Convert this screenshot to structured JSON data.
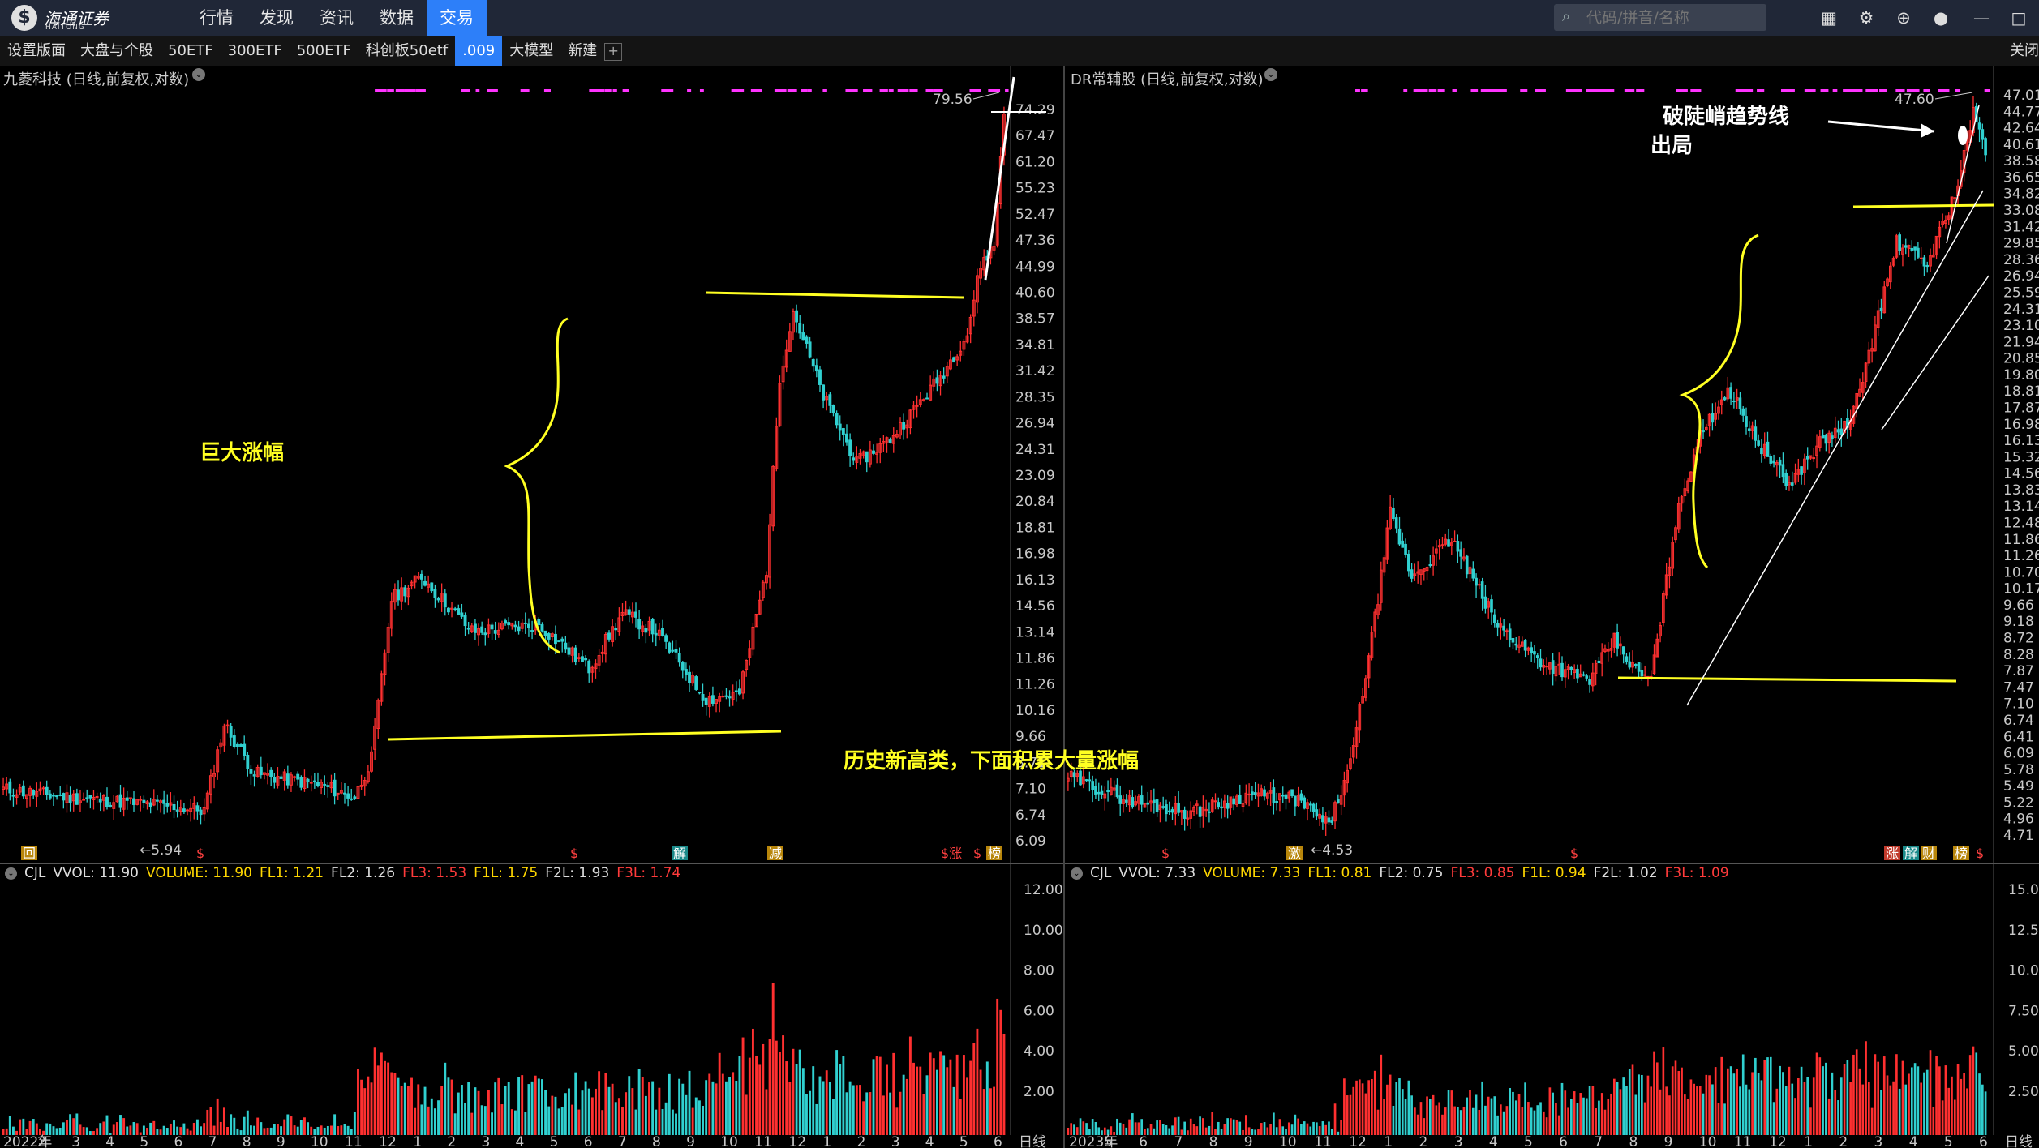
{
  "app": {
    "logo_glyph": "$",
    "logo_name": "海通证券",
    "logo_sub": "HAITONG"
  },
  "nav": [
    {
      "label": "行情",
      "active": false
    },
    {
      "label": "发现",
      "active": false
    },
    {
      "label": "资讯",
      "active": false
    },
    {
      "label": "数据",
      "active": false
    },
    {
      "label": "交易",
      "active": true
    }
  ],
  "search": {
    "placeholder": "代码/拼音/名称",
    "icon": "search-icon"
  },
  "top_icons": [
    "grid-icon",
    "gear-icon",
    "globe-icon",
    "chat-icon"
  ],
  "window_controls": {
    "minimize": "—",
    "maximize": "□"
  },
  "toolbar": {
    "items": [
      {
        "label": "设置版面",
        "active": false
      },
      {
        "label": "大盘与个股",
        "active": false
      },
      {
        "label": "50ETF",
        "active": false
      },
      {
        "label": "300ETF",
        "active": false
      },
      {
        "label": "500ETF",
        "active": false
      },
      {
        "label": "科创板50etf",
        "active": false
      },
      {
        "label": ".009",
        "active": true
      },
      {
        "label": "大模型",
        "active": false
      },
      {
        "label": "新建",
        "active": false
      }
    ],
    "plus": "+",
    "right_label": "关闭"
  },
  "left_panel": {
    "title": "九菱科技 (日线,前复权,对数)",
    "y_labels": [
      "74.29",
      "67.47",
      "61.20",
      "55.23",
      "52.47",
      "47.36",
      "44.99",
      "40.60",
      "38.57",
      "34.81",
      "31.42",
      "28.35",
      "26.94",
      "24.31",
      "23.09",
      "20.84",
      "18.81",
      "16.98",
      "16.13",
      "14.56",
      "13.14",
      "11.86",
      "11.26",
      "10.16",
      "9.66",
      "8.71",
      "7.10",
      "6.74",
      "6.09"
    ],
    "high_label": "79.56",
    "low_label": "←5.94",
    "annotation_big": "巨大涨幅",
    "annotation_history": "历史新高类，下面积累大量涨幅",
    "markers": [
      "回",
      "$",
      "$",
      "解",
      "减",
      "$涨",
      "$",
      "榜"
    ],
    "indicator": {
      "name": "CJL",
      "items": [
        {
          "text": "VVOL: 11.90",
          "color": "#dddddd"
        },
        {
          "text": "VOLUME: 11.90",
          "color": "#ffd700"
        },
        {
          "text": "FL1: 1.21",
          "color": "#ffd700"
        },
        {
          "text": "FL2: 1.26",
          "color": "#dddddd"
        },
        {
          "text": "FL3: 1.53",
          "color": "#ff3b3b"
        },
        {
          "text": "F1L: 1.75",
          "color": "#ffd700"
        },
        {
          "text": "F2L: 1.93",
          "color": "#dddddd"
        },
        {
          "text": "F3L: 1.74",
          "color": "#ff3b3b"
        }
      ]
    },
    "vol_labels": [
      "12.00",
      "10.00",
      "8.00",
      "6.00",
      "4.00",
      "2.00"
    ],
    "x_labels": [
      "2022年",
      "2",
      "3",
      "4",
      "5",
      "6",
      "7",
      "8",
      "9",
      "10",
      "11",
      "12",
      "1",
      "2",
      "3",
      "4",
      "5",
      "6",
      "7",
      "8",
      "9",
      "10",
      "11",
      "12",
      "1",
      "2",
      "3",
      "4",
      "5",
      "6"
    ],
    "period_label": "日线"
  },
  "right_panel": {
    "title": "DR常辅股 (日线,前复权,对数)",
    "y_labels": [
      "47.01",
      "44.77",
      "42.64",
      "40.61",
      "38.58",
      "36.65",
      "34.82",
      "33.08",
      "31.42",
      "29.85",
      "28.36",
      "26.94",
      "25.59",
      "24.31",
      "23.10",
      "21.94",
      "20.85",
      "19.80",
      "18.81",
      "17.87",
      "16.98",
      "16.13",
      "15.32",
      "14.56",
      "13.83",
      "13.14",
      "12.48",
      "11.86",
      "11.26",
      "10.70",
      "10.17",
      "9.66",
      "9.18",
      "8.72",
      "8.28",
      "7.87",
      "7.47",
      "7.10",
      "6.74",
      "6.41",
      "6.09",
      "5.78",
      "5.49",
      "5.22",
      "4.96",
      "4.71"
    ],
    "high_label": "47.60",
    "low_label": "←4.53",
    "annotation_break": "破陡峭趋势线",
    "annotation_exit": "出局",
    "markers": [
      "$",
      "激",
      "$",
      "涨",
      "解",
      "财",
      "榜",
      "$"
    ],
    "indicator": {
      "name": "CJL",
      "items": [
        {
          "text": "VVOL: 7.33",
          "color": "#dddddd"
        },
        {
          "text": "VOLUME: 7.33",
          "color": "#ffd700"
        },
        {
          "text": "FL1: 0.81",
          "color": "#ffd700"
        },
        {
          "text": "FL2: 0.75",
          "color": "#dddddd"
        },
        {
          "text": "FL3: 0.85",
          "color": "#ff3b3b"
        },
        {
          "text": "F1L: 0.94",
          "color": "#ffd700"
        },
        {
          "text": "F2L: 1.02",
          "color": "#dddddd"
        },
        {
          "text": "F3L: 1.09",
          "color": "#ff3b3b"
        }
      ]
    },
    "vol_labels": [
      "15.00",
      "12.50",
      "10.00",
      "7.50",
      "5.00",
      "2.50"
    ],
    "x_labels": [
      "2023年",
      "5",
      "6",
      "7",
      "8",
      "9",
      "10",
      "11",
      "12",
      "1",
      "2",
      "3",
      "4",
      "5",
      "6",
      "7",
      "8",
      "9",
      "10",
      "11",
      "12",
      "1",
      "2",
      "3",
      "4",
      "5",
      "6"
    ],
    "period_label": "日线"
  },
  "colors": {
    "up": "#ff3030",
    "down": "#30d0d0",
    "annotation": "#ffff22",
    "signal_row": "#ff33ff",
    "nav_active": "#2d7ff9"
  }
}
